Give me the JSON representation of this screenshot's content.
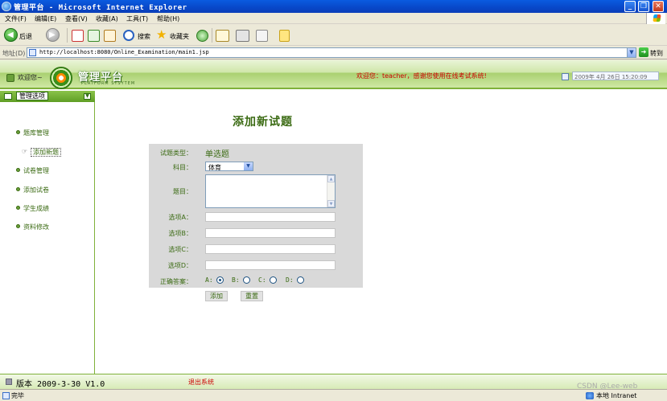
{
  "window": {
    "title": "管理平台 - Microsoft Internet Explorer",
    "min_label": "_",
    "max_label": "❐",
    "close_label": "✕"
  },
  "menu": [
    "文件(F)",
    "编辑(E)",
    "查看(V)",
    "收藏(A)",
    "工具(T)",
    "帮助(H)"
  ],
  "toolbar": {
    "back_label": "后退",
    "search_label": "搜索",
    "favorites_label": "收藏夹"
  },
  "address": {
    "label": "地址(D)",
    "url": "http://localhost:8080/Online_Examination/main1.jsp",
    "go_label": "转到"
  },
  "header": {
    "welcome_label": "欢迎您~",
    "logo_title": "管理平台",
    "logo_subtitle": "PLATFORM SYSYTEM",
    "message": "欢迎您：teacher，感谢您使用在线考试系统!",
    "datetime": "2009年 4月 26日 15:20:09"
  },
  "sidebar": {
    "title": "管理选项",
    "items": [
      {
        "label": "题库管理"
      },
      {
        "label": "添加新题"
      },
      {
        "label": "试卷管理"
      },
      {
        "label": "添加试卷"
      },
      {
        "label": "学生成绩"
      },
      {
        "label": "资料修改"
      }
    ]
  },
  "form": {
    "page_title": "添加新试题",
    "type_label": "试题类型：",
    "type_value": "单选题",
    "subject_label": "科目：",
    "subject_value": "体育",
    "question_label": "题目：",
    "option_a_label": "选项A：",
    "option_b_label": "选项B：",
    "option_c_label": "选项C：",
    "option_d_label": "选项D：",
    "answer_label": "正确答案：",
    "answers": [
      {
        "label": "A:",
        "checked": true
      },
      {
        "label": "B:",
        "checked": false
      },
      {
        "label": "C:",
        "checked": false
      },
      {
        "label": "D:",
        "checked": false
      }
    ],
    "submit_label": "添加",
    "reset_label": "重置"
  },
  "footer": {
    "version": "版本 2009-3-30 V1.0",
    "logout": "退出系统"
  },
  "statusbar": {
    "status": "完毕",
    "watermark": "CSDN @Lee-web",
    "zone": "本地 Intranet"
  }
}
